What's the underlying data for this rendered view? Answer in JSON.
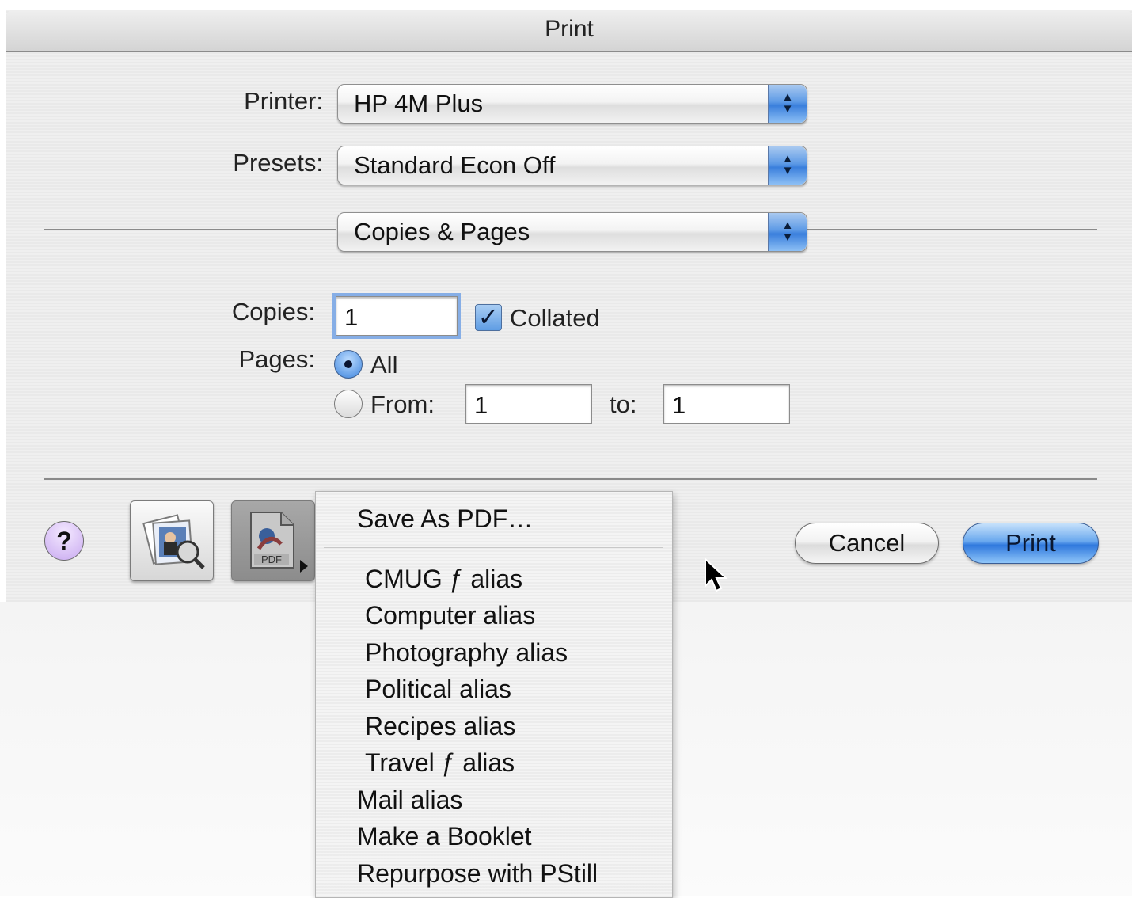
{
  "dialog": {
    "title": "Print",
    "printer": {
      "label": "Printer:",
      "value": "HP 4M Plus"
    },
    "presets": {
      "label": "Presets:",
      "value": "Standard Econ Off"
    },
    "pane": {
      "value": "Copies & Pages"
    },
    "copies": {
      "label": "Copies:",
      "value": "1",
      "collated_label": "Collated",
      "collated_checked": true
    },
    "pages": {
      "label": "Pages:",
      "all_label": "All",
      "all_selected": true,
      "from_label": "From:",
      "from_value": "1",
      "to_label": "to:",
      "to_value": "1"
    },
    "buttons": {
      "help": "?",
      "cancel": "Cancel",
      "print": "Print"
    },
    "pdf_button_label": "PDF"
  },
  "pdf_menu": {
    "items": [
      "Save As PDF…",
      "CMUG ƒ alias",
      "Computer alias",
      "Photography alias",
      "Political alias",
      "Recipes alias",
      "Travel ƒ alias",
      "Mail alias",
      "Make a Booklet",
      "Repurpose with PStill"
    ]
  },
  "icons": {
    "preview": "preview-icon",
    "pdf": "pdf-workflow-icon",
    "help": "help-icon",
    "cursor": "mouse-pointer-icon"
  },
  "colors": {
    "accent_blue": "#3a7fdc",
    "help_purple": "#c8a9f0"
  }
}
